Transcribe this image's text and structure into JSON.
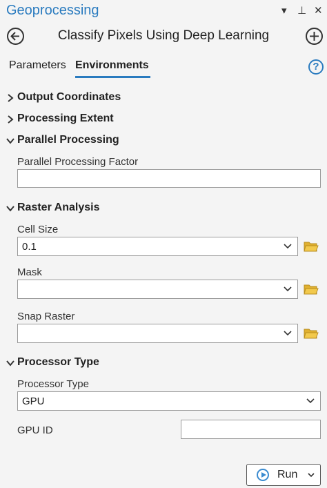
{
  "pane": {
    "title": "Geoprocessing",
    "controls": [
      "▾",
      "⊥",
      "✕"
    ]
  },
  "tool": {
    "name": "Classify Pixels Using Deep Learning"
  },
  "tabs": [
    {
      "label": "Parameters",
      "active": false
    },
    {
      "label": "Environments",
      "active": true
    }
  ],
  "help": "?",
  "sections": {
    "output_coordinates": {
      "label": "Output Coordinates",
      "expanded": false
    },
    "processing_extent": {
      "label": "Processing Extent",
      "expanded": false
    },
    "parallel_processing": {
      "label": "Parallel Processing",
      "expanded": true,
      "factor_label": "Parallel Processing Factor",
      "factor_value": ""
    },
    "raster_analysis": {
      "label": "Raster Analysis",
      "expanded": true,
      "cell_size_label": "Cell Size",
      "cell_size_value": "0.1",
      "mask_label": "Mask",
      "mask_value": "",
      "snap_raster_label": "Snap Raster",
      "snap_raster_value": ""
    },
    "processor_type": {
      "label": "Processor Type",
      "expanded": true,
      "type_label": "Processor Type",
      "type_value": "GPU",
      "gpu_id_label": "GPU ID",
      "gpu_id_value": ""
    }
  },
  "run": {
    "label": "Run"
  },
  "colors": {
    "accent": "#2a7bbf",
    "folder": "#e0b030"
  }
}
